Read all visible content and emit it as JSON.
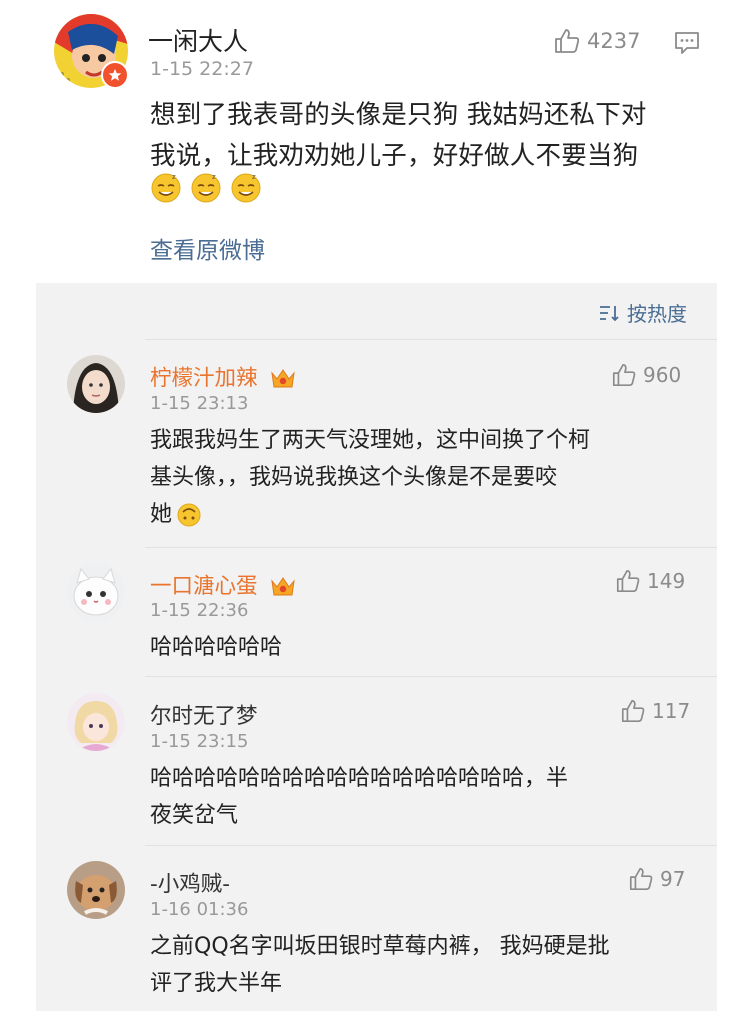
{
  "main_comment": {
    "username": "一闲大人",
    "timestamp": "1-15 22:27",
    "likes": "4237",
    "text_line1": "想到了我表哥的头像是只狗 我姑妈还私下对",
    "text_line2": "我说，让我劝劝她儿子，好好做人不要当狗",
    "emojis": [
      "sleepy-face-emoji",
      "sleepy-face-emoji",
      "sleepy-face-emoji"
    ],
    "view_original": "查看原微博"
  },
  "sort": {
    "label": "按热度"
  },
  "replies": [
    {
      "username": "柠檬汁加辣",
      "vip": true,
      "timestamp": "1-15 23:13",
      "likes": "960",
      "lines": [
        "我跟我妈生了两天气没理她，这中间换了个柯",
        "基头像，，我妈说我换这个头像是不是要咬",
        "她"
      ]
    },
    {
      "username": "一口溏心蛋",
      "vip": true,
      "timestamp": "1-15 22:36",
      "likes": "149",
      "lines": [
        "哈哈哈哈哈哈"
      ]
    },
    {
      "username": "尔时无了梦",
      "vip": false,
      "timestamp": "1-15 23:15",
      "likes": "117",
      "lines": [
        "哈哈哈哈哈哈哈哈哈哈哈哈哈哈哈哈哈，半",
        "夜笑岔气"
      ]
    },
    {
      "username": "-小鸡贼-",
      "vip": false,
      "timestamp": "1-16 01:36",
      "likes": "97",
      "lines": [
        "之前QQ名字叫坂田银时草莓内裤， 我妈硬是批",
        "评了我大半年"
      ]
    }
  ],
  "colors": {
    "link": "#4a6d94",
    "vip_name": "#e8742d",
    "panel_bg": "#f2f2f2",
    "meta": "#999999"
  }
}
